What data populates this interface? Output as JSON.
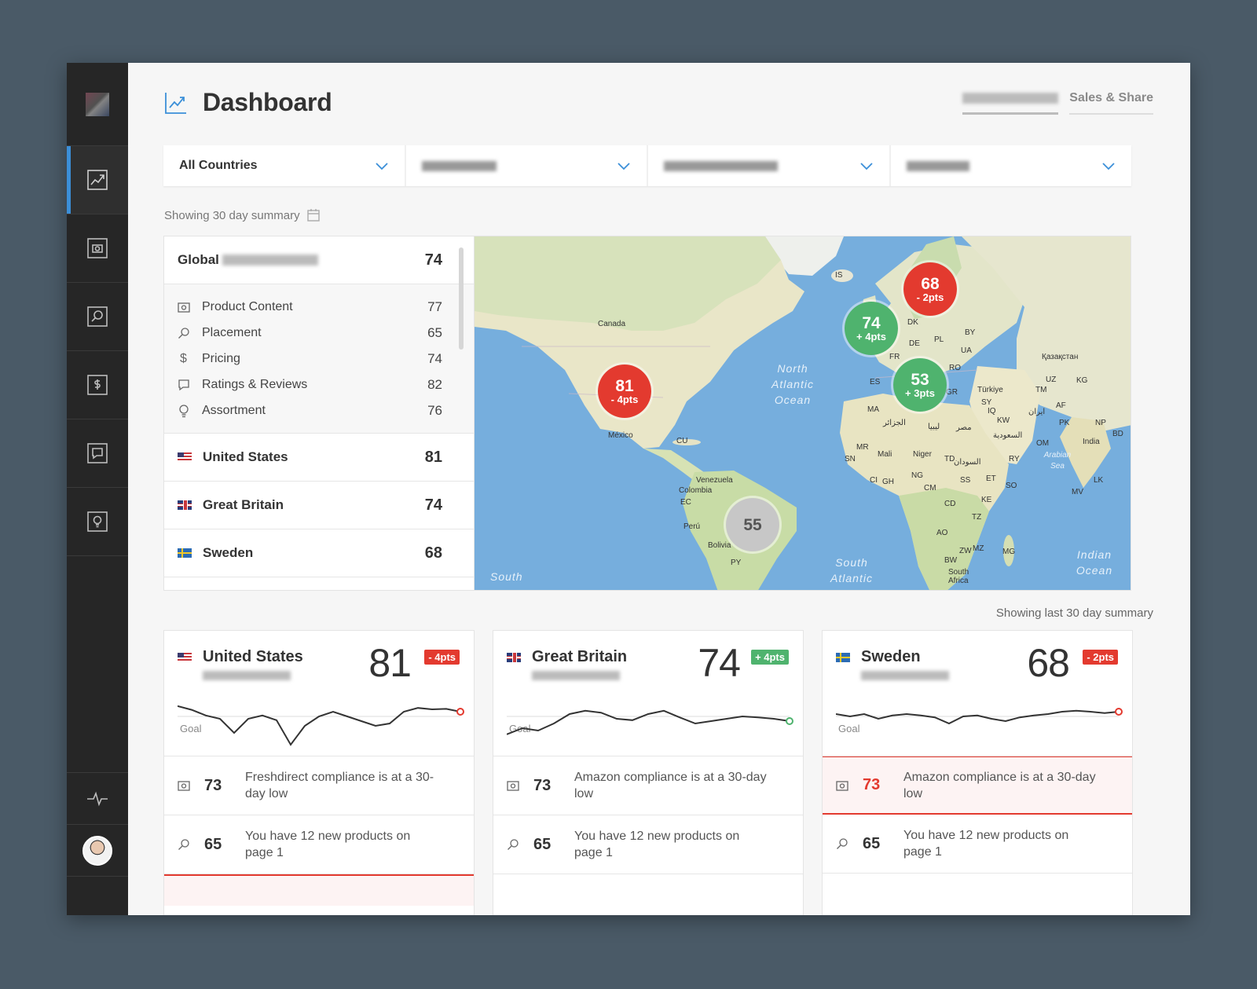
{
  "header": {
    "title": "Dashboard",
    "tabs": [
      {
        "label": "",
        "blurred": true
      },
      {
        "label": "Sales & Share"
      }
    ]
  },
  "filters": [
    {
      "label": "All Countries",
      "blurred": false
    },
    {
      "label": "",
      "blurred": true
    },
    {
      "label": "",
      "blurred": true
    },
    {
      "label": "",
      "blurred": true
    }
  ],
  "summary_note": "Showing 30 day summary",
  "summary_note_right": "Showing last 30 day summary",
  "scores": {
    "global": {
      "label": "Global",
      "value": "74"
    },
    "metrics": [
      {
        "icon": "camera-icon",
        "label": "Product Content",
        "value": "77"
      },
      {
        "icon": "search-icon",
        "label": "Placement",
        "value": "65"
      },
      {
        "icon": "dollar-icon",
        "label": "Pricing",
        "value": "74"
      },
      {
        "icon": "comment-icon",
        "label": "Ratings & Reviews",
        "value": "82"
      },
      {
        "icon": "bulb-icon",
        "label": "Assortment",
        "value": "76"
      }
    ],
    "countries": [
      {
        "name": "United States",
        "flag": "us",
        "value": "81"
      },
      {
        "name": "Great Britain",
        "flag": "gb",
        "value": "74"
      },
      {
        "name": "Sweden",
        "flag": "se",
        "value": "68"
      }
    ]
  },
  "map": {
    "bubbles": [
      {
        "value": "68",
        "delta": "- 2pts",
        "color": "red"
      },
      {
        "value": "74",
        "delta": "+ 4pts",
        "color": "green"
      },
      {
        "value": "53",
        "delta": "+ 3pts",
        "color": "green"
      },
      {
        "value": "81",
        "delta": "- 4pts",
        "color": "red"
      },
      {
        "value": "55",
        "delta": "",
        "color": "grey"
      }
    ],
    "labels": {
      "canada": "Canada",
      "mexico": "México",
      "cu": "CU",
      "venezuela": "Venezuela",
      "colombia": "Colombia",
      "ec": "EC",
      "peru": "Perú",
      "bolivia": "Bolivia",
      "py": "PY",
      "is": "IS",
      "dk": "DK",
      "de": "DE",
      "pl": "PL",
      "by": "BY",
      "ua": "UA",
      "fr": "FR",
      "es": "ES",
      "ro": "RO",
      "gr": "GR",
      "turkiye": "Türkiye",
      "kazakhstan": "Қазақстан",
      "uz": "UZ",
      "kg": "KG",
      "tm": "TM",
      "af": "AF",
      "pk": "PK",
      "india": "India",
      "np": "NP",
      "bd": "BD",
      "lk": "LK",
      "mv": "MV",
      "ma": "MA",
      "mr": "MR",
      "mali": "Mali",
      "niger": "Niger",
      "td": "TD",
      "sn": "SN",
      "gh": "GH",
      "ci": "CI",
      "ng": "NG",
      "cm": "CM",
      "ss": "SS",
      "et": "ET",
      "so": "SO",
      "ke": "KE",
      "cd": "CD",
      "tz": "TZ",
      "ao": "AO",
      "zw": "ZW",
      "mz": "MZ",
      "mg": "MG",
      "bw": "BW",
      "south_africa": "South Africa",
      "sy": "SY",
      "iq": "IQ",
      "kw": "KW",
      "ry": "RY",
      "om": "OM",
      "algeria": "الجزائر",
      "libya": "ليبيا",
      "egypt": "مصر",
      "sudan": "السودان",
      "saudi": "السعودية",
      "iran": "ایران"
    },
    "oceans": {
      "north_atlantic": "North Atlantic Ocean",
      "south_atlantic": "South Atlantic",
      "indian": "Indian Ocean",
      "arabian": "Arabian Sea",
      "south_left": "South"
    }
  },
  "cards": [
    {
      "country": "United States",
      "flag": "us",
      "score": "81",
      "delta": "- 4pts",
      "delta_color": "red",
      "goal_label": "Goal",
      "end_color": "#e33a2f",
      "spark": [
        0.18,
        0.26,
        0.38,
        0.45,
        0.75,
        0.45,
        0.38,
        0.48,
        1.0,
        0.6,
        0.4,
        0.3,
        0.4,
        0.5,
        0.6,
        0.55,
        0.3,
        0.22,
        0.25,
        0.24,
        0.3
      ],
      "alerts": [
        {
          "icon": "camera-icon",
          "value": "73",
          "text": "Freshdirect compliance is at a 30-day low",
          "highlight": false
        },
        {
          "icon": "search-icon",
          "value": "65",
          "text": "You have 12 new products on page 1",
          "highlight": false
        }
      ],
      "footer_red": true
    },
    {
      "country": "Great Britain",
      "flag": "gb",
      "score": "74",
      "delta": "+ 4pts",
      "delta_color": "green",
      "goal_label": "Goal",
      "end_color": "#4fb36e",
      "spark": [
        0.78,
        0.65,
        0.7,
        0.55,
        0.35,
        0.28,
        0.32,
        0.45,
        0.48,
        0.35,
        0.28,
        0.42,
        0.55,
        0.5,
        0.45,
        0.4,
        0.42,
        0.45,
        0.5
      ],
      "alerts": [
        {
          "icon": "camera-icon",
          "value": "73",
          "text": "Amazon compliance is at a 30-day low",
          "highlight": false
        },
        {
          "icon": "search-icon",
          "value": "65",
          "text": "You have 12 new products on page 1",
          "highlight": false
        }
      ],
      "footer_red": false
    },
    {
      "country": "Sweden",
      "flag": "se",
      "score": "68",
      "delta": "- 2pts",
      "delta_color": "red",
      "goal_label": "Goal",
      "end_color": "#e33a2f",
      "spark": [
        0.35,
        0.4,
        0.35,
        0.45,
        0.38,
        0.35,
        0.38,
        0.42,
        0.55,
        0.4,
        0.38,
        0.45,
        0.5,
        0.42,
        0.38,
        0.35,
        0.3,
        0.28,
        0.3,
        0.33,
        0.3
      ],
      "alerts": [
        {
          "icon": "camera-icon",
          "value": "73",
          "text": "Amazon compliance is at a 30-day low",
          "highlight": true
        },
        {
          "icon": "search-icon",
          "value": "65",
          "text": "You have 12 new products on page 1",
          "highlight": false
        }
      ],
      "footer_red": false
    }
  ],
  "colors": {
    "accent": "#3b8fd8",
    "red": "#e33a2f",
    "green": "#4fb36e",
    "sidebar": "#262626"
  }
}
